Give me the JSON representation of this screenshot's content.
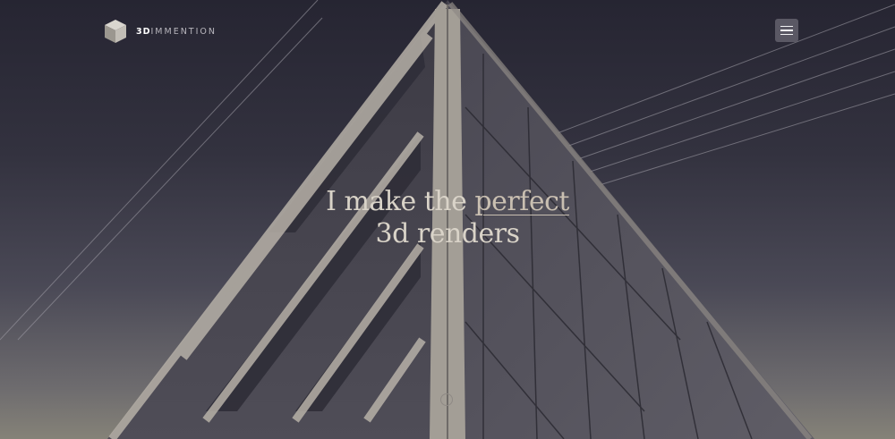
{
  "header": {
    "logo_text_strong": "3D",
    "logo_text_rest": "IMMENTION",
    "logo_icon": "cube-icon",
    "menu_icon": "hamburger-menu-icon"
  },
  "hero": {
    "headline_part1": "I make the ",
    "headline_accent": "perfect",
    "headline_line2": "3d renders",
    "scroll_icon": "scroll-indicator-icon"
  },
  "colors": {
    "background": "#2b2a36",
    "headline": "#d9d3c8",
    "menu_button": "#5a5864"
  }
}
